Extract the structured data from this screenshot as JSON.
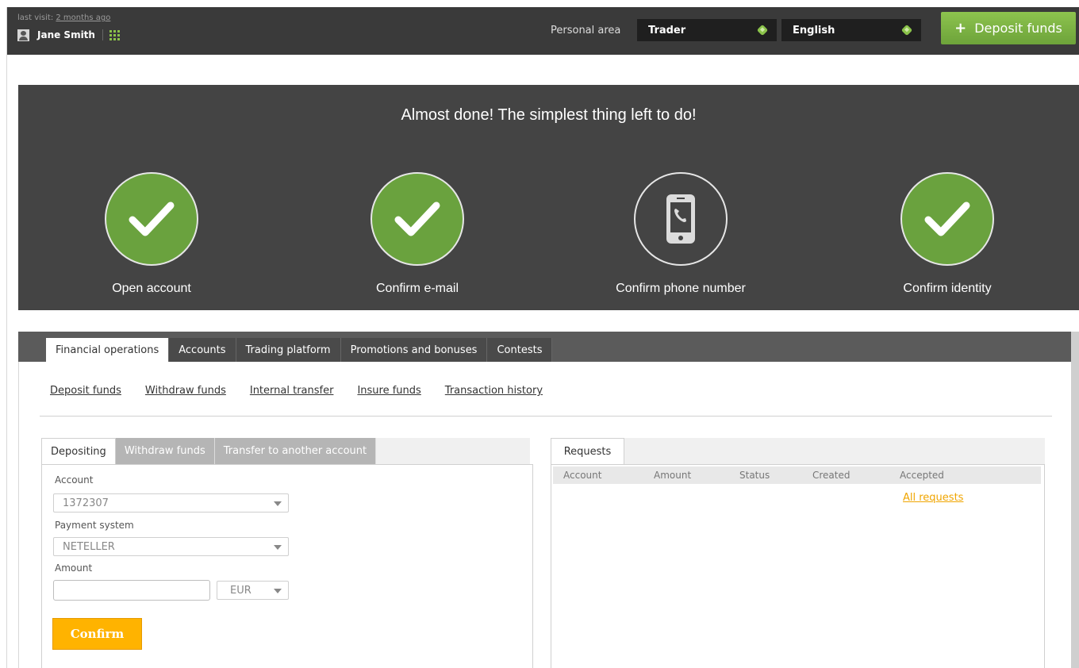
{
  "header": {
    "last_visit_prefix": "last visit:",
    "last_visit_value": "2 months ago",
    "user_name": "Jane Smith",
    "personal_area_label": "Personal area",
    "role_select": "Trader",
    "language_select": "English",
    "deposit_button": "Deposit funds"
  },
  "banner": {
    "title": "Almost done! The simplest thing left to do!",
    "steps": [
      {
        "label": "Open account",
        "status": "done",
        "icon": "check-icon"
      },
      {
        "label": "Confirm e-mail",
        "status": "done",
        "icon": "check-icon"
      },
      {
        "label": "Confirm phone number",
        "status": "pending",
        "icon": "phone-icon"
      },
      {
        "label": "Confirm identity",
        "status": "done",
        "icon": "check-icon"
      }
    ]
  },
  "main_tabs": [
    "Financial operations",
    "Accounts",
    "Trading platform",
    "Promotions and bonuses",
    "Contests"
  ],
  "sub_links": [
    "Deposit funds",
    "Withdraw funds",
    "Internal transfer",
    "Insure funds",
    "Transaction history"
  ],
  "deposit_panel": {
    "tabs": [
      "Depositing",
      "Withdraw funds",
      "Transfer to another account"
    ],
    "account_label": "Account",
    "account_value": "1372307",
    "payment_label": "Payment system",
    "payment_value": "NETELLER",
    "amount_label": "Amount",
    "amount_value": "",
    "currency_value": "EUR",
    "confirm_button": "Confirm"
  },
  "requests_panel": {
    "tab": "Requests",
    "columns": [
      "Account",
      "Amount",
      "Status",
      "Created",
      "Accepted"
    ],
    "all_requests_link": "All requests"
  },
  "colors": {
    "accent_green": "#6aa23e",
    "confirm_orange": "#ffb300",
    "link_orange": "#f0a500",
    "dark_bg": "#444444"
  }
}
